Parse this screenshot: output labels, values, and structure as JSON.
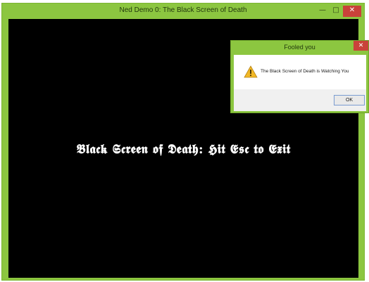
{
  "main_window": {
    "title": "Ned Demo 0: The Black Screen of Death",
    "minimize_glyph": "—",
    "maximize_glyph": "□",
    "close_glyph": "✕",
    "accent_color": "#8cc640",
    "close_color": "#c9423a"
  },
  "screen": {
    "text": "𝕭𝖑𝖆𝖈𝖐 𝕾𝖈𝖗𝖊𝖊𝖓 𝖔𝖋 𝕯𝖊𝖆𝖙𝖍: 𝕳𝖎𝖙 𝕰𝖘𝖈 𝖙𝖔 𝕰𝖝𝖎𝖙",
    "background": "#000000"
  },
  "dialog": {
    "title": "Fooled you",
    "close_glyph": "✕",
    "icon": "warning-icon",
    "message": "The Black Screen of Death is Watching You",
    "ok_label": "OK"
  }
}
